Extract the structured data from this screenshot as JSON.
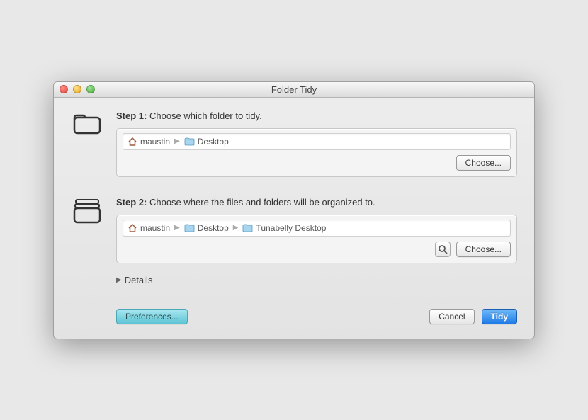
{
  "window": {
    "title": "Folder Tidy"
  },
  "step1": {
    "label": "Step 1:",
    "text": "Choose which folder to tidy.",
    "path": [
      "maustin",
      "Desktop"
    ],
    "choose": "Choose..."
  },
  "step2": {
    "label": "Step 2:",
    "text": "Choose where the files and folders will be organized to.",
    "path": [
      "maustin",
      "Desktop",
      "Tunabelly Desktop"
    ],
    "choose": "Choose..."
  },
  "details": "Details",
  "footer": {
    "preferences": "Preferences...",
    "cancel": "Cancel",
    "tidy": "Tidy"
  }
}
